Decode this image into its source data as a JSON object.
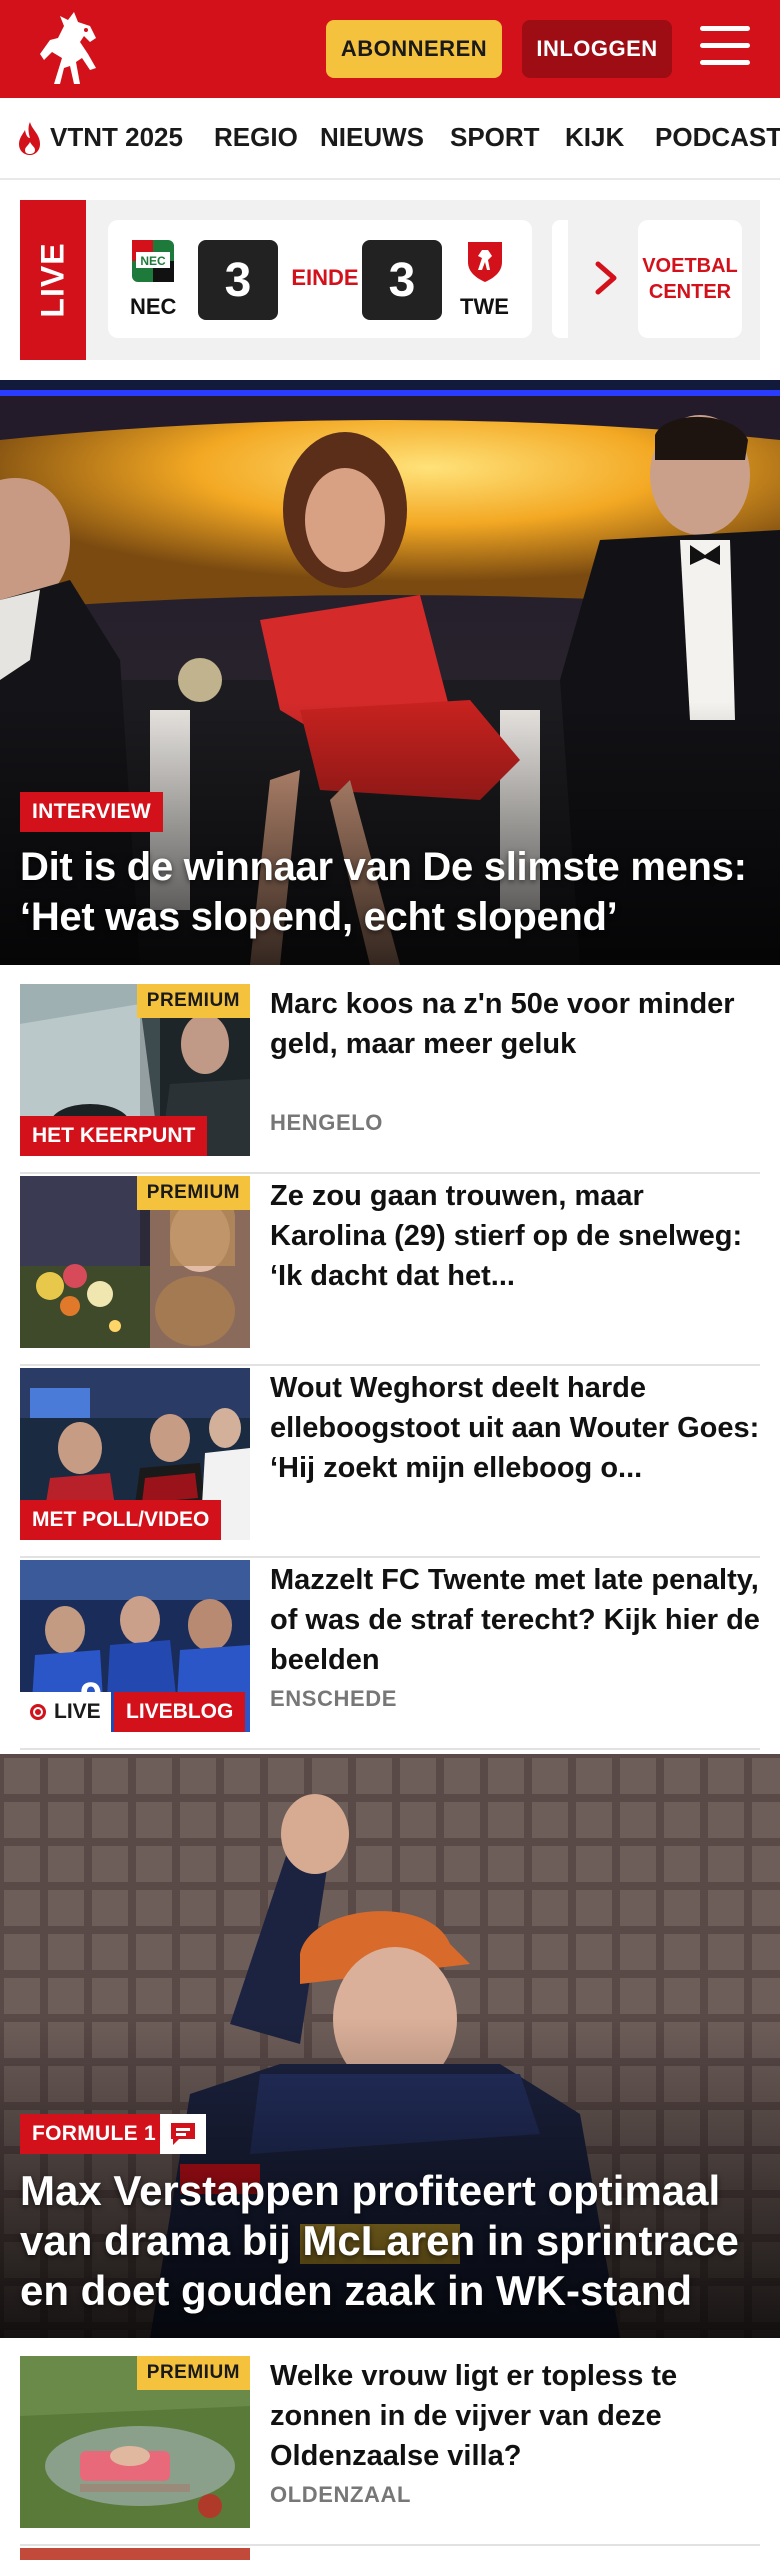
{
  "header": {
    "subscribe_label": "ABONNEREN",
    "login_label": "INLOGGEN",
    "brand_color": "#d3111b",
    "subscribe_color": "#f5c23e"
  },
  "nav": {
    "items": [
      "VTNT 2025",
      "REGIO",
      "NIEUWS",
      "SPORT",
      "KIJK",
      "PODCAST"
    ]
  },
  "live": {
    "tab_label": "LIVE",
    "match": {
      "home": "NEC",
      "away": "TWE",
      "home_score": "3",
      "away_score": "3",
      "status": "EINDE"
    },
    "voetbal_center_label": "VOETBAL CENTER"
  },
  "hero": {
    "tag": "INTERVIEW",
    "title": "Dit is de winnaar van De slimste mens: ‘Het was slopend, echt slopend’"
  },
  "articles": [
    {
      "title": "Marc koos na z'n 50e voor minder geld, maar meer geluk",
      "location": "HENGELO",
      "premium": "PREMIUM",
      "tag": "HET KEERPUNT"
    },
    {
      "title": "Ze zou gaan trouwen, maar Karolina (29) stierf op de snelweg: ‘Ik dacht dat het...",
      "premium": "PREMIUM"
    },
    {
      "title": "Wout Weghorst deelt harde elleboogstoot uit aan Wouter Goes: ‘Hij zoekt mijn elleboog o...",
      "tag": "MET POLL/VIDEO"
    },
    {
      "title": "Mazzelt FC Twente met late penalty, of was de straf terecht? Kijk hier de beelden",
      "location": "ENSCHEDE",
      "live_label": "LIVE",
      "tag": "LIVEBLOG"
    }
  ],
  "hero2": {
    "tag": "FORMULE 1",
    "title": "Max Verstappen profiteert optimaal van drama bij McLaren in sprintrace en doet gouden zaak in WK-stand"
  },
  "articles2": [
    {
      "title": "Welke vrouw ligt er topless te zonnen in de vijver van deze Oldenzaalse villa?",
      "location": "OLDENZAAL",
      "premium": "PREMIUM"
    }
  ]
}
